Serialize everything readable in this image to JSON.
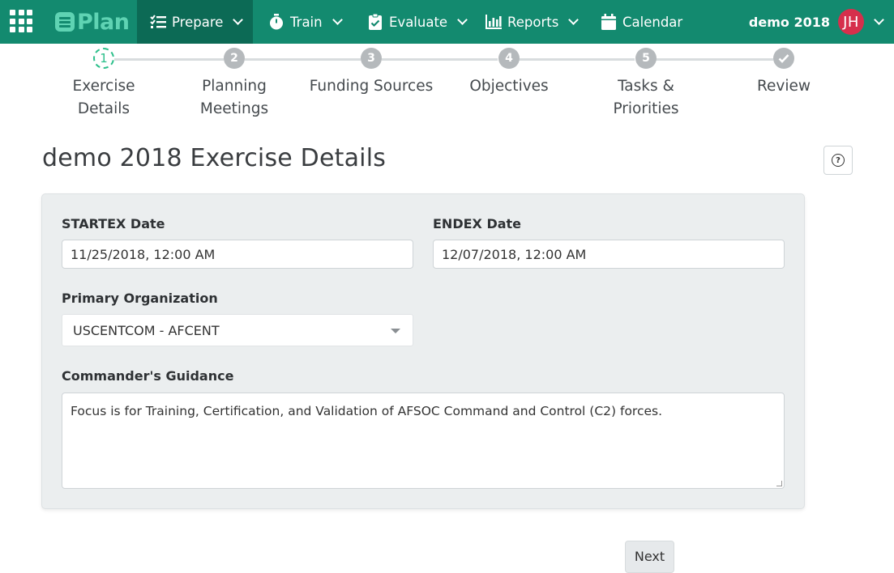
{
  "app": {
    "logo_text": "Plan"
  },
  "nav": {
    "items": [
      {
        "label": "Prepare",
        "icon": "checklist-icon",
        "has_menu": true
      },
      {
        "label": "Train",
        "icon": "stopwatch-icon",
        "has_menu": true
      },
      {
        "label": "Evaluate",
        "icon": "clipboard-check-icon",
        "has_menu": true
      },
      {
        "label": "Reports",
        "icon": "bar-chart-icon",
        "has_menu": true
      },
      {
        "label": "Calendar",
        "icon": "calendar-icon",
        "has_menu": false
      }
    ],
    "active": "Prepare"
  },
  "user": {
    "name": "demo 2018",
    "initials": "JH",
    "avatar_color": "#d62f4c"
  },
  "stepper": {
    "steps": [
      {
        "number": "1",
        "label_line1": "Exercise",
        "label_line2": "Details",
        "state": "current"
      },
      {
        "number": "2",
        "label_line1": "Planning",
        "label_line2": "Meetings",
        "state": "pending"
      },
      {
        "number": "3",
        "label_line1": "Funding Sources",
        "label_line2": "",
        "state": "pending"
      },
      {
        "number": "4",
        "label_line1": "Objectives",
        "label_line2": "",
        "state": "pending"
      },
      {
        "number": "5",
        "label_line1": "Tasks &",
        "label_line2": "Priorities",
        "state": "pending"
      },
      {
        "number": "",
        "label_line1": "Review",
        "label_line2": "",
        "state": "check"
      }
    ]
  },
  "page": {
    "title": "demo 2018 Exercise Details"
  },
  "form": {
    "startex_label": "STARTEX Date",
    "startex_value": "11/25/2018, 12:00 AM",
    "endex_label": "ENDEX Date",
    "endex_value": "12/07/2018, 12:00 AM",
    "org_label": "Primary Organization",
    "org_value": "USCENTCOM - AFCENT",
    "guidance_label": "Commander's Guidance",
    "guidance_value": "Focus is for Training, Certification, and Validation of AFSOC Command and Control (C2) forces."
  },
  "actions": {
    "next_label": "Next"
  },
  "colors": {
    "nav_bg": "#138a6f",
    "nav_active": "#0c6a55",
    "logo": "#5fd3b3",
    "step_current": "#2bbf8a",
    "step_pending": "#b5b9bc"
  }
}
